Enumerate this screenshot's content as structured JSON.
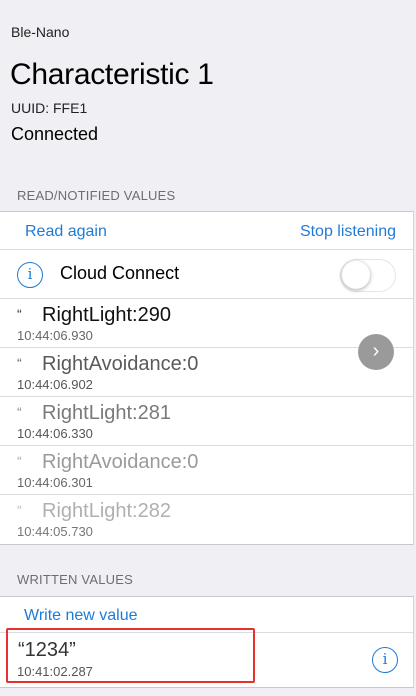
{
  "header": {
    "device_name": "Ble-Nano",
    "characteristic_title": "Characteristic 1",
    "uuid": "UUID: FFE1",
    "status": "Connected"
  },
  "read_section": {
    "heading": "READ/NOTIFIED VALUES",
    "read_again_label": "Read again",
    "stop_listening_label": "Stop listening",
    "cloud_connect_label": "Cloud Connect",
    "cloud_connect_enabled": false,
    "values": [
      {
        "quote": "“",
        "text": "RightLight:290",
        "time": "10:44:06.930"
      },
      {
        "quote": "“",
        "text": "RightAvoidance:0",
        "time": "10:44:06.902"
      },
      {
        "quote": "“",
        "text": "RightLight:281",
        "time": "10:44:06.330"
      },
      {
        "quote": "“",
        "text": "RightAvoidance:0",
        "time": "10:44:06.301"
      },
      {
        "quote": "“",
        "text": "RightLight:282",
        "time": "10:44:05.730"
      }
    ]
  },
  "written_section": {
    "heading": "WRITTEN VALUES",
    "write_new_label": "Write new value",
    "values": [
      {
        "text": "“1234”",
        "time": "10:41:02.287"
      }
    ]
  },
  "icons": {
    "info": "i",
    "chevron_right": "›"
  },
  "colors": {
    "accent": "#1f7bd8",
    "highlight": "#e8302e",
    "background": "#efeff4"
  }
}
